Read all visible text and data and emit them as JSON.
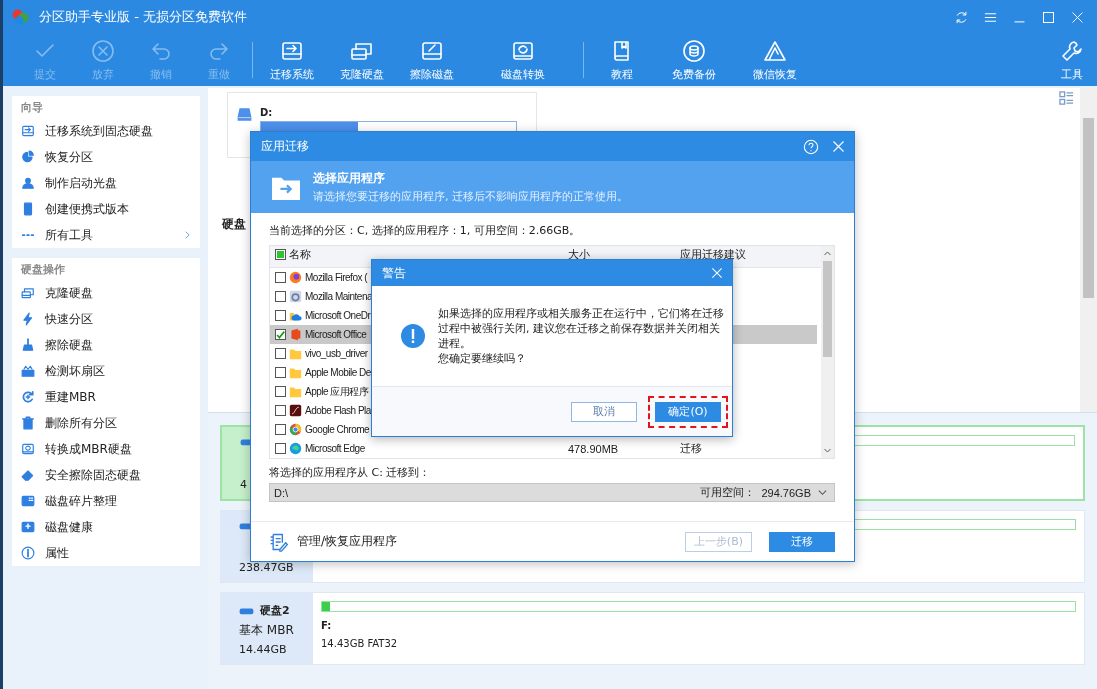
{
  "window": {
    "title": "分区助手专业版 - 无损分区免费软件"
  },
  "toolbar": {
    "groups": [
      [
        {
          "label": "提交",
          "kind": "check",
          "disabled": true
        },
        {
          "label": "放弃",
          "kind": "cancel",
          "disabled": true
        },
        {
          "label": "撤销",
          "kind": "undo",
          "disabled": true
        },
        {
          "label": "重做",
          "kind": "redo",
          "disabled": true
        }
      ],
      [
        {
          "label": "迁移系统",
          "kind": "disk-arrow",
          "disabled": false
        },
        {
          "label": "克隆硬盘",
          "kind": "disk-copy",
          "disabled": false
        },
        {
          "label": "擦除磁盘",
          "kind": "disk-slash",
          "disabled": false
        },
        {
          "label": "磁盘转换",
          "kind": "disk-cycle",
          "disabled": false
        }
      ],
      [
        {
          "label": "教程",
          "kind": "book",
          "disabled": false
        },
        {
          "label": "免费备份",
          "kind": "database",
          "disabled": false
        },
        {
          "label": "微信恢复",
          "kind": "letter-a",
          "disabled": false
        }
      ],
      [
        {
          "label": "工具",
          "kind": "wrench",
          "disabled": false
        }
      ]
    ]
  },
  "sidebar": [
    {
      "title": "向导",
      "items": [
        {
          "label": "迁移系统到固态硬盘",
          "kind": "disk-arrow",
          "expandable": false
        },
        {
          "label": "恢复分区",
          "kind": "pie",
          "expandable": false
        },
        {
          "label": "制作启动光盘",
          "kind": "person",
          "expandable": false
        },
        {
          "label": "创建便携式版本",
          "kind": "usb-stick",
          "expandable": false
        },
        {
          "label": "所有工具",
          "kind": "dots",
          "expandable": true
        }
      ]
    },
    {
      "title": "硬盘操作",
      "items": [
        {
          "label": "克隆硬盘",
          "kind": "disk-copy",
          "expandable": false
        },
        {
          "label": "快速分区",
          "kind": "bolt",
          "expandable": false
        },
        {
          "label": "擦除硬盘",
          "kind": "broom",
          "expandable": false
        },
        {
          "label": "检测坏扇区",
          "kind": "scan",
          "expandable": false
        },
        {
          "label": "重建MBR",
          "kind": "refresh-plus",
          "expandable": false
        },
        {
          "label": "删除所有分区",
          "kind": "trash",
          "expandable": false
        },
        {
          "label": "转换成MBR硬盘",
          "kind": "disk-cycle",
          "expandable": false
        },
        {
          "label": "安全擦除固态硬盘",
          "kind": "eraser",
          "expandable": false
        },
        {
          "label": "磁盘碎片整理",
          "kind": "disk-grid",
          "expandable": false
        },
        {
          "label": "磁盘健康",
          "kind": "disk-plus",
          "expandable": false
        },
        {
          "label": "属性",
          "kind": "info",
          "expandable": false
        }
      ]
    }
  ],
  "main": {
    "partition": {
      "label": "D:",
      "level": 0.38
    },
    "heading": "硬盘",
    "disks": [
      {
        "selected": true,
        "size": "4"
      },
      {
        "selected": false,
        "size": "238.47GB"
      },
      {
        "selected": false,
        "name": "硬盘2",
        "type": "基本 MBR",
        "size": "14.44GB",
        "partition": {
          "label": "F:",
          "info": "14.43GB FAT32",
          "level": 0.01
        }
      }
    ]
  },
  "app_dialog": {
    "title": "应用迁移",
    "heading": "选择应用程序",
    "subtitle": "请选择您要迁移的应用程序, 迁移后不影响应用程序的正常使用。",
    "summary": "当前选择的分区：C, 选择的应用程序：1, 可用空间：2.66GB。",
    "select_all": {
      "checked": true
    },
    "columns": [
      "名称",
      "大小",
      "应用迁移建议"
    ],
    "rows": [
      {
        "name": "Mozilla Firefox (",
        "kind": "orb",
        "checked": false,
        "selected": false
      },
      {
        "name": "Mozilla Maintena",
        "kind": "gear",
        "checked": false,
        "selected": false
      },
      {
        "name": "Microsoft OneDr",
        "kind": "cloud",
        "checked": false,
        "selected": false
      },
      {
        "name": "Microsoft Office",
        "kind": "tile",
        "checked": true,
        "selected": true
      },
      {
        "name": "vivo_usb_driver",
        "kind": "folder",
        "checked": false,
        "selected": false
      },
      {
        "name": "Apple Mobile De",
        "kind": "folder",
        "checked": false,
        "selected": false
      },
      {
        "name": "Apple 应用程序",
        "kind": "folder",
        "checked": false,
        "selected": false
      },
      {
        "name": "Adobe Flash Pla",
        "kind": "flash",
        "checked": false,
        "selected": false
      },
      {
        "name": "Google Chrome",
        "kind": "ring",
        "checked": false,
        "selected": false
      },
      {
        "name": "Microsoft Edge",
        "kind": "swirl",
        "size": "478.90MB",
        "advice": "迁移",
        "checked": false,
        "selected": false
      }
    ],
    "target_label": "将选择的应用程序从 C: 迁移到：",
    "target": {
      "value": "D:\\",
      "free_label": "可用空间：",
      "free": "294.76GB"
    },
    "manage_link": "管理/恢复应用程序",
    "buttons": [
      {
        "label": "上一步(B)",
        "kind": "secondary",
        "disabled": true
      },
      {
        "label": "迁移",
        "kind": "primary",
        "disabled": false
      }
    ]
  },
  "warning": {
    "title": "警告",
    "message": "如果选择的应用程序或相关服务正在运行中，它们将在迁移过程中被强行关闭, 建议您在迁移之前保存数据并关闭相关进程。",
    "question": "您确定要继续吗？",
    "buttons": [
      {
        "label": "取消",
        "kind": "secondary",
        "highlighted": false
      },
      {
        "label": "确定(O)",
        "kind": "primary",
        "highlighted": true
      }
    ]
  }
}
